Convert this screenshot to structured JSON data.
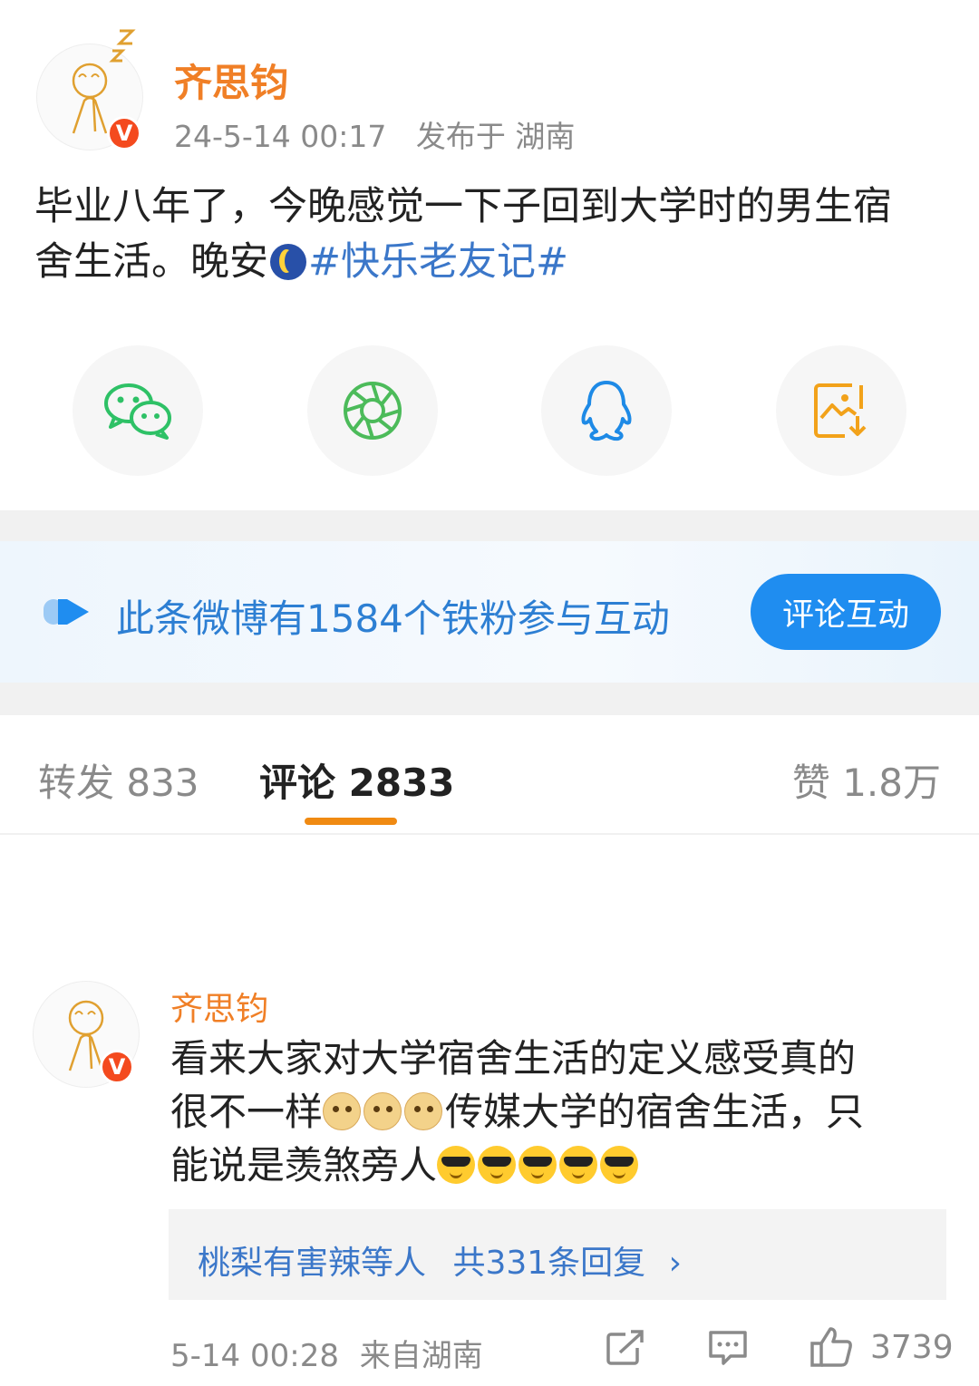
{
  "post": {
    "author": "齐思钧",
    "time": "24-5-14 00:17",
    "location": "发布于 湖南",
    "text_line1": "毕业八年了，今晚感觉一下子回到大学时的男生宿",
    "text_line2": "舍生活。晚安",
    "hashtag": "#快乐老友记#",
    "verified_badge": "V"
  },
  "share": {
    "items": [
      {
        "icon": "wechat-icon",
        "color": "#2ec166"
      },
      {
        "icon": "moments-icon",
        "color": "#4cbb5a"
      },
      {
        "icon": "qq-icon",
        "color": "#1e8ae6"
      },
      {
        "icon": "save-image-icon",
        "color": "#f2a21a"
      }
    ]
  },
  "fan_banner": {
    "text": "此条微博有1584个铁粉参与互动",
    "button": "评论互动"
  },
  "tabs": {
    "repost": "转发 833",
    "comments": "评论 2833",
    "likes": "赞 1.8万"
  },
  "comment": {
    "author": "齐思钧",
    "line1": "看来大家对大学宿舍生活的定义感受真的",
    "line2_pre": "很不一样",
    "line2_post": "传媒大学的宿舍生活，只",
    "line3": "能说是羡煞旁人",
    "replies_by": "桃梨有害辣等人",
    "replies_count": "共331条回复",
    "chevron": "›",
    "time": "5-14 00:28",
    "location": "来自湖南",
    "like_count": "3739"
  },
  "colors": {
    "accent_orange": "#f07f26",
    "link_blue": "#3b77c9",
    "button_blue": "#1f8df0"
  }
}
